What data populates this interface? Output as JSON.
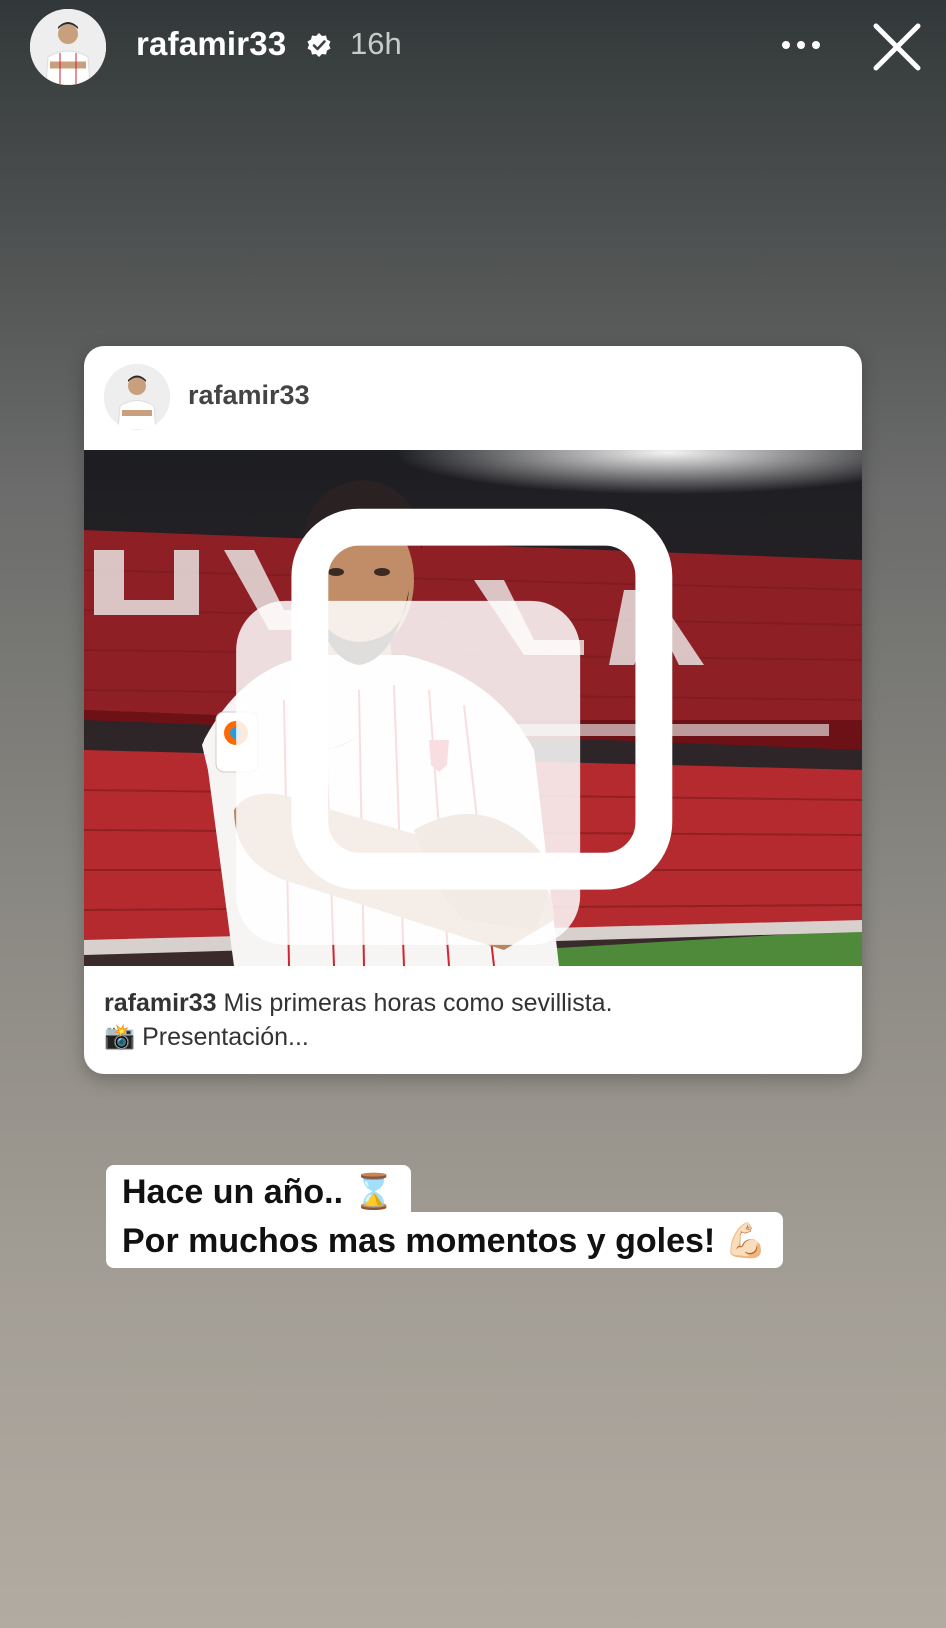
{
  "header": {
    "username": "rafamir33",
    "time": "16h",
    "more_icon": "more-horizontal-icon",
    "close_icon": "close-icon",
    "verified_icon": "verified-badge-icon"
  },
  "post": {
    "username": "rafamir33",
    "caption_user": "rafamir33",
    "caption_text": "Mis primeras horas como sevillista.",
    "caption_line2": "📸 Presentación..."
  },
  "sticker": {
    "line1_text": "Hace un año..",
    "line1_emoji": "⌛",
    "line2_text": "Por muchos mas momentos y goles!",
    "line2_emoji": "💪🏻"
  },
  "colors": {
    "text_white": "#ffffff",
    "time_gray": "#c9cbcb",
    "card_bg": "#ffffff"
  }
}
